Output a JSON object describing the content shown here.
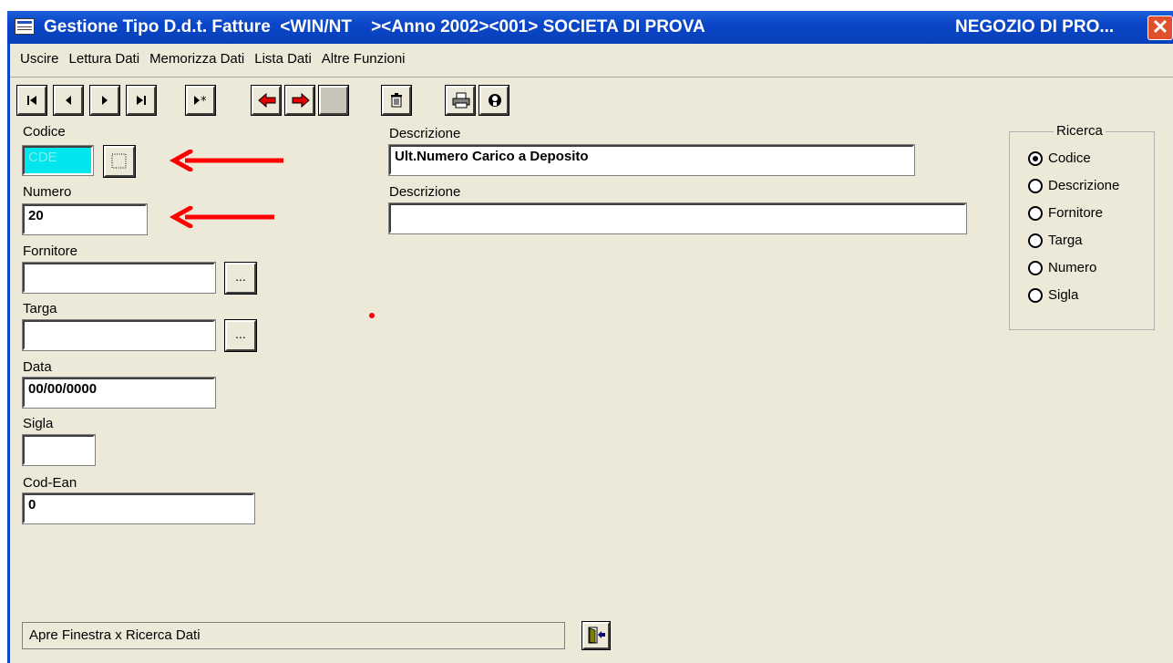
{
  "window": {
    "title": "Gestione Tipo D.d.t. Fatture  <WIN/NT    ><Anno 2002><001> SOCIETA DI PROVA",
    "title_right": "NEGOZIO DI PRO...",
    "close_glyph": "✕"
  },
  "menu": [
    "Uscire",
    "Lettura Dati",
    "Memorizza Dati",
    "Lista Dati",
    "Altre Funzioni"
  ],
  "toolbar": {
    "icons": [
      "first-record-icon",
      "previous-record-icon",
      "next-record-icon",
      "last-record-icon",
      "new-record-icon",
      "back-arrow-icon",
      "forward-arrow-icon",
      "blank-icon",
      "trash-icon",
      "print-icon",
      "help-icon"
    ]
  },
  "form": {
    "codice_label": "Codice",
    "codice_value": "CDE",
    "numero_label": "Numero",
    "numero_value": "20",
    "fornitore_label": "Fornitore",
    "fornitore_value": "",
    "targa_label": "Targa",
    "targa_value": "",
    "data_label": "Data",
    "data_value": "00/00/0000",
    "sigla_label": "Sigla",
    "sigla_value": "",
    "codean_label": "Cod-Ean",
    "codean_value": "0",
    "descrizione1_label": "Descrizione",
    "descrizione1_value": "Ult.Numero Carico a Deposito",
    "descrizione2_label": "Descrizione",
    "descrizione2_value": "",
    "ellipsis": "..."
  },
  "ricerca": {
    "title": "Ricerca",
    "options": [
      "Codice",
      "Descrizione",
      "Fornitore",
      "Targa",
      "Numero",
      "Sigla"
    ],
    "selected": "Codice"
  },
  "status_text": "Apre Finestra x Ricerca Dati",
  "colors": {
    "title_bar": "#0a46c8",
    "codice_bg": "#00e5ee",
    "codice_text": "#7fe8e8",
    "annotation_arrow": "#ff0000"
  }
}
